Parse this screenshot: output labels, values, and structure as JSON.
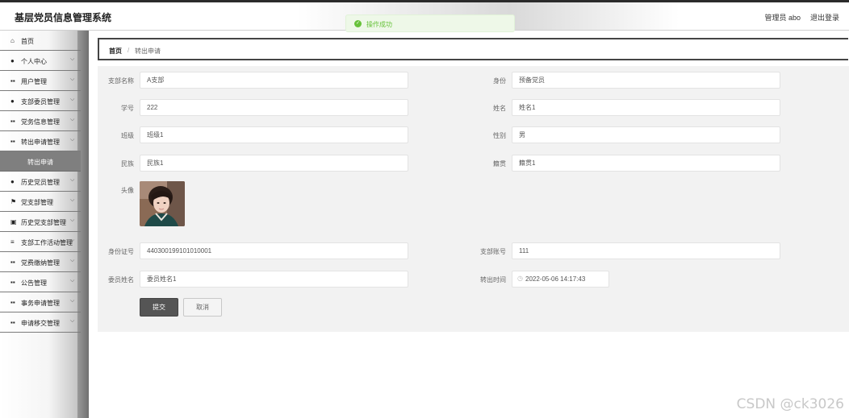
{
  "header": {
    "title": "基层党员信息管理系统",
    "user": "管理员 abo",
    "logout": "退出登录"
  },
  "toast": {
    "message": "操作成功"
  },
  "sidebar": {
    "items": [
      {
        "label": "首页",
        "icon": "home-icon",
        "glyph": "⌂",
        "chevron": false
      },
      {
        "label": "个人中心",
        "icon": "user-icon",
        "glyph": "●",
        "chevron": true
      },
      {
        "label": "用户管理",
        "icon": "grid-icon",
        "glyph": "▪▪",
        "chevron": true
      },
      {
        "label": "支部委员管理",
        "icon": "user-icon",
        "glyph": "●",
        "chevron": true
      },
      {
        "label": "党务信息管理",
        "icon": "grid-icon",
        "glyph": "▪▪",
        "chevron": true
      },
      {
        "label": "转出申请管理",
        "icon": "grid-icon",
        "glyph": "▪▪",
        "chevron": true
      },
      {
        "label": "历史党员管理",
        "icon": "user-icon",
        "glyph": "●",
        "chevron": true
      },
      {
        "label": "党支部管理",
        "icon": "flag-icon",
        "glyph": "⚑",
        "chevron": true
      },
      {
        "label": "历史党支部管理",
        "icon": "archive-icon",
        "glyph": "▣",
        "chevron": true
      },
      {
        "label": "支部工作活动管理",
        "icon": "list-icon",
        "glyph": "≡",
        "chevron": true
      },
      {
        "label": "党费缴纳管理",
        "icon": "grid-icon",
        "glyph": "▪▪",
        "chevron": true
      },
      {
        "label": "公告管理",
        "icon": "grid-icon",
        "glyph": "▪▪",
        "chevron": true
      },
      {
        "label": "事务申请管理",
        "icon": "grid-icon",
        "glyph": "▪▪",
        "chevron": true
      },
      {
        "label": "申请移交管理",
        "icon": "grid-icon",
        "glyph": "▪▪",
        "chevron": true
      }
    ],
    "active_sub": "转出申请"
  },
  "breadcrumb": {
    "home": "首页",
    "separator": "/",
    "current": "转出申请"
  },
  "form": {
    "branch_name": {
      "label": "支部名称",
      "value": "A支部"
    },
    "identity": {
      "label": "身份",
      "value": "预备党员"
    },
    "student_no": {
      "label": "学号",
      "value": "222"
    },
    "name": {
      "label": "姓名",
      "value": "姓名1"
    },
    "class": {
      "label": "班级",
      "value": "班级1"
    },
    "gender": {
      "label": "性别",
      "value": "男"
    },
    "ethnicity": {
      "label": "民族",
      "value": "民族1"
    },
    "native_place": {
      "label": "籍贯",
      "value": "籍贯1"
    },
    "avatar": {
      "label": "头像"
    },
    "id_card": {
      "label": "身份证号",
      "value": "440300199101010001"
    },
    "branch_account": {
      "label": "支部账号",
      "value": "111"
    },
    "committee_name": {
      "label": "委员姓名",
      "value": "委员姓名1"
    },
    "transfer_time": {
      "label": "转出时间",
      "value": "2022-05-06 14:17:43"
    },
    "submit": "提交",
    "cancel": "取消"
  },
  "watermark": "CSDN @ck3026"
}
